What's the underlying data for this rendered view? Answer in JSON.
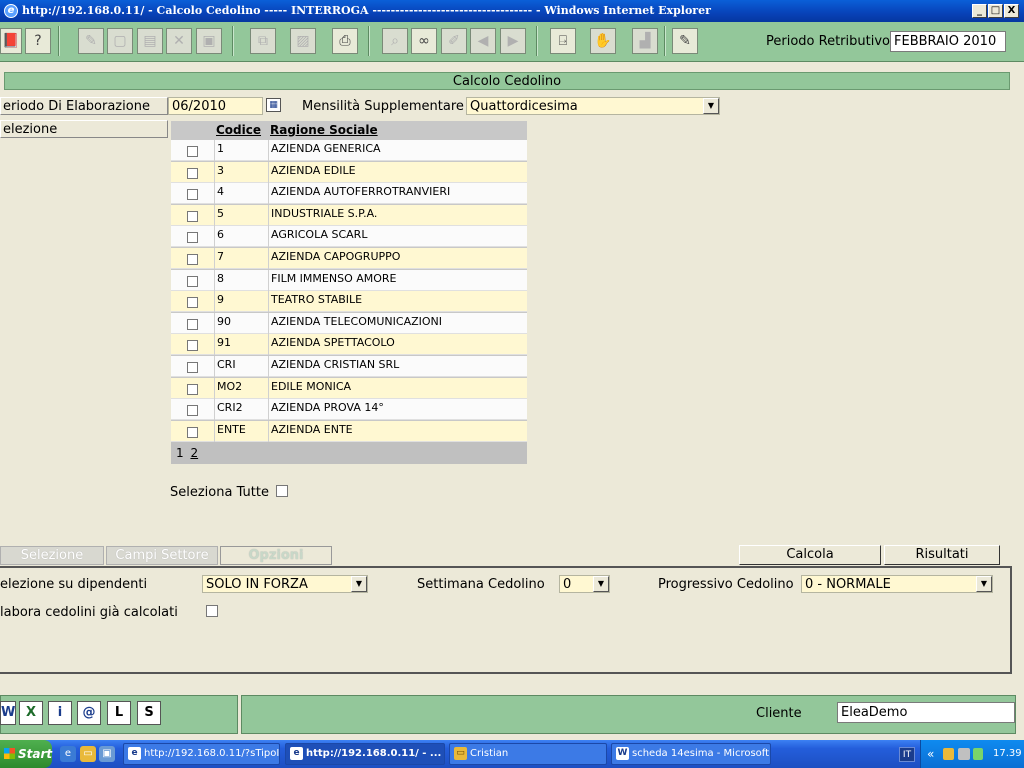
{
  "window": {
    "title": "http://192.168.0.11/ - Calcolo Cedolino ----- INTERROGA ----------------------------------- - Windows Internet Explorer",
    "minimize": "_",
    "maximize": "□",
    "close": "X"
  },
  "toolbar": {
    "periodo_label": "Periodo Retributivo",
    "periodo_value": "FEBBRAIO 2010"
  },
  "section_title": "Calcolo Cedolino",
  "form": {
    "periodo_elab_label": "eriodo Di Elaborazione",
    "periodo_elab_value": "06/2010",
    "mensilita_label": "Mensilità Supplementare",
    "mensilita_value": "Quattordicesima",
    "selezione_label": "elezione"
  },
  "grid": {
    "headers": {
      "codice": "Codice",
      "ragione": "Ragione Sociale"
    },
    "rows": [
      {
        "codice": "1",
        "ragione": "AZIENDA GENERICA"
      },
      {
        "codice": "3",
        "ragione": "AZIENDA EDILE"
      },
      {
        "codice": "4",
        "ragione": "AZIENDA AUTOFERROTRANVIERI"
      },
      {
        "codice": "5",
        "ragione": "INDUSTRIALE S.P.A."
      },
      {
        "codice": "6",
        "ragione": "AGRICOLA SCARL"
      },
      {
        "codice": "7",
        "ragione": "AZIENDA CAPOGRUPPO"
      },
      {
        "codice": "8",
        "ragione": "FILM IMMENSO AMORE"
      },
      {
        "codice": "9",
        "ragione": "TEATRO STABILE"
      },
      {
        "codice": "90",
        "ragione": "AZIENDA TELECOMUNICAZIONI"
      },
      {
        "codice": "91",
        "ragione": "AZIENDA SPETTACOLO"
      },
      {
        "codice": "CRI",
        "ragione": "AZIENDA CRISTIAN SRL"
      },
      {
        "codice": "MO2",
        "ragione": "EDILE MONICA"
      },
      {
        "codice": "CRI2",
        "ragione": "AZIENDA PROVA 14°"
      },
      {
        "codice": "ENTE",
        "ragione": "AZIENDA ENTE"
      }
    ],
    "page_current": "1",
    "page_next": "2"
  },
  "seleziona_tutte_label": "Seleziona Tutte",
  "tabs": {
    "selezione": "Selezione",
    "campi_settore": "Campi Settore",
    "opzioni": "Opzioni"
  },
  "buttons": {
    "calcola": "Calcola",
    "risultati": "Risultati"
  },
  "options": {
    "selezione_dip_label": "elezione su dipendenti",
    "selezione_dip_value": "SOLO IN FORZA",
    "settimana_label": "Settimana Cedolino",
    "settimana_value": "0",
    "progressivo_label": "Progressivo Cedolino",
    "progressivo_value": "0 - NORMALE",
    "rielabora_label": "labora cedolini già calcolati"
  },
  "bottom": {
    "cliente_label": "Cliente",
    "cliente_value": "EleaDemo",
    "icons": [
      "W",
      "X",
      "i",
      "@",
      "L",
      "S"
    ]
  },
  "taskbar": {
    "start": "Start",
    "tasks": [
      "http://192.168.0.11/?sTipoI...",
      "http://192.168.0.11/ - ...",
      "Cristian",
      "scheda 14esima - Microsoft ..."
    ],
    "lang": "IT",
    "tray_prefix": "«",
    "clock": "17.39"
  },
  "colors": {
    "toolbar_green": "#93c79a",
    "field_yellow": "#fff8d2",
    "xp_blue": "#245edb"
  }
}
